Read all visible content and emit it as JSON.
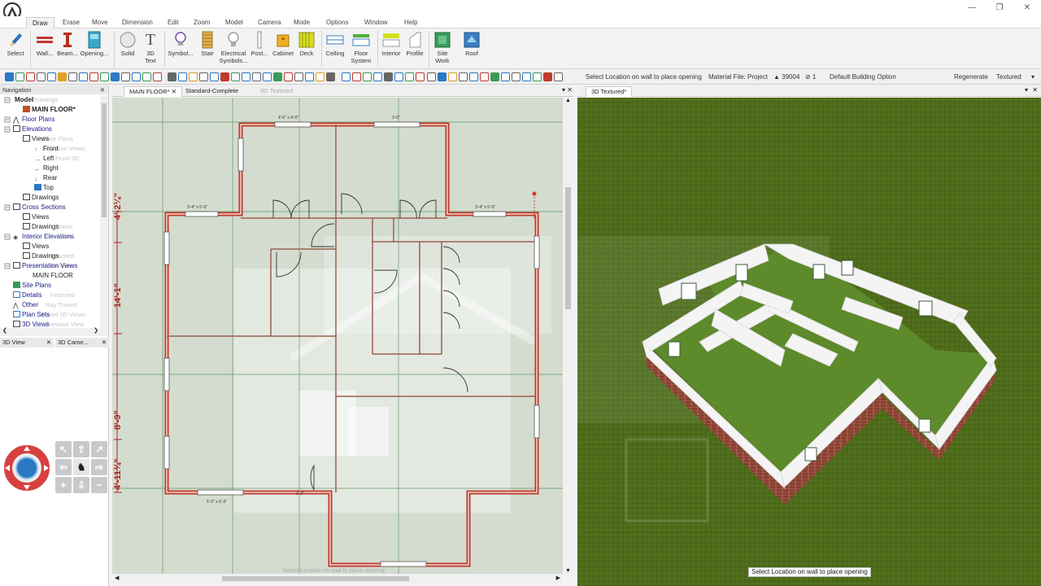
{
  "menu": {
    "items": [
      "Draw",
      "Erase",
      "Move",
      "Dimension",
      "Edit",
      "Zoom",
      "Model",
      "Camera",
      "Mode",
      "Options",
      "Window",
      "Help"
    ],
    "active": "Draw"
  },
  "ribbon": {
    "select": "Select",
    "wall": "Wall...",
    "beam": "Beam...",
    "opening": "Opening...",
    "solid": "Solid",
    "text3d_1": "3D",
    "text3d_2": "Text",
    "symbol": "Symbol...",
    "stair": "Stair",
    "electrical_1": "Electrical",
    "electrical_2": "Symbols...",
    "post": "Post...",
    "cabinet": "Cabinet",
    "deck": "Deck",
    "ceiling": "Ceiling",
    "floor_1": "Floor",
    "floor_2": "System",
    "interior": "Interior",
    "profile": "Profile",
    "site_1": "Site",
    "site_2": "Work",
    "roof": "Roof"
  },
  "toolbar2": {
    "status": "Select Location on wall to place opening",
    "material_file": "Material File: Project",
    "count": "▲ 39004",
    "layer": "⊘ 1",
    "building_option": "Default Building Option",
    "regenerate": "Regenerate",
    "textured": "Textured"
  },
  "nav": {
    "title": "Navigation",
    "close": "✕",
    "tree": {
      "model": "Model",
      "main_floor": "MAIN FLOOR*",
      "floor_plans": "Floor Plans",
      "elevations": "Elevations",
      "views": "Views",
      "front": "Front",
      "left": "Left",
      "right": "Right",
      "rear": "Rear",
      "top": "Top",
      "drawings": "Drawings",
      "cross_sections": "Cross Sections",
      "cs_views": "Views",
      "cs_drawings": "Drawings",
      "interior_elevations": "Interior Elevations",
      "ie_views": "Views",
      "ie_drawings": "Drawings",
      "presentation_views": "Presentation Views",
      "pv_main_floor": "MAIN FLOOR",
      "site_plans": "Site Plans",
      "details": "Details",
      "other": "Other",
      "plan_sets": "Plan Sets",
      "views_3d": "3D Views"
    },
    "ghost": {
      "g1": "Drawings",
      "g2": "Floor Plans",
      "g3": "Elevation Views",
      "g4": "Front 3D",
      "g5": "Frame",
      "g6": "Line",
      "g7": "Attached",
      "g8": "Sections",
      "g9": "Featured",
      "g10": "Ray Traced",
      "g11": "Saved 3D Views",
      "g12": "Previous View"
    }
  },
  "panes": {
    "view3d": "3D View",
    "camera": "3D Came..."
  },
  "plan_tabs": {
    "main": "MAIN FLOOR*",
    "standard": "Standard-Complete",
    "textured": "3D Textured"
  },
  "view3d_tabs": {
    "textured": "3D Textured*"
  },
  "plan": {
    "dim_left_1": "4'-2¼\"",
    "dim_left_2": "14'-1\"",
    "dim_left_3": "8'-9\"",
    "dim_left_4": "4'-11¾\"",
    "win_top_1": "4'-0\" x 4'-0\"",
    "win_top_2": "3'-0\"",
    "win_left_1": "3'-4\" x 5'-0\"",
    "win_right_1": "3'-4\" x 5'-0\"",
    "win_bottom_1": "5'-0\" x 5'-0\"",
    "win_bottom_2": "3'-0\"",
    "status_ghost": "Select Location on wall to place opening"
  },
  "view3d": {
    "status": "Select Location on wall to place opening"
  },
  "colors": {
    "wall": "#c0392b",
    "grass": "#4d6b1a",
    "accent": "#2b78c5"
  }
}
